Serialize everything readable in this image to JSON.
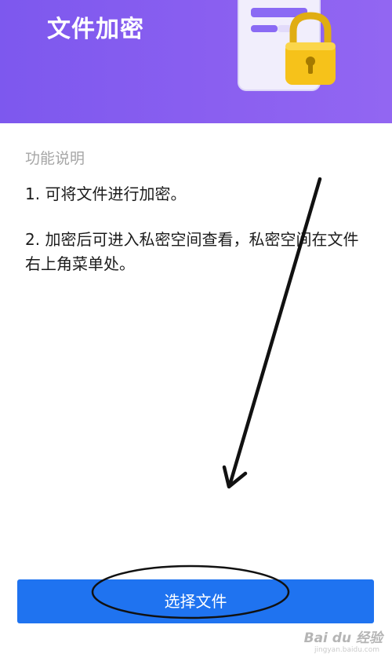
{
  "header": {
    "title": "文件加密",
    "illustration_icon": "document-lock-icon"
  },
  "content": {
    "section_label": "功能说明",
    "items": [
      "1. 可将文件进行加密。",
      "2. 加密后可进入私密空间查看，私密空间在文件右上角菜单处。"
    ]
  },
  "footer": {
    "select_button_label": "选择文件"
  },
  "watermark": {
    "text": "Bai du 经验",
    "sub": "jingyan.baidu.com"
  },
  "colors": {
    "header_purple": "#8a5ff0",
    "button_blue": "#1f73f0",
    "lock_yellow": "#f6c21a",
    "annotation": "#111111"
  }
}
